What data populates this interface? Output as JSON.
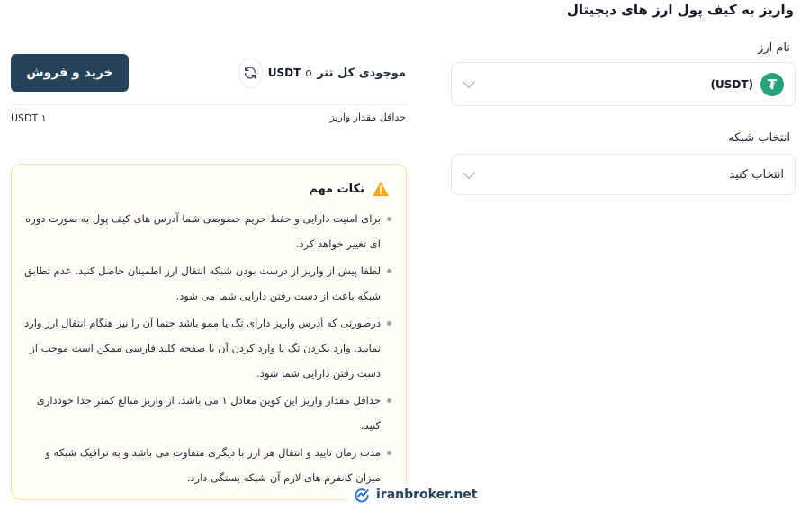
{
  "page": {
    "title": "واریز به کیف پول ارز های دیجیتال"
  },
  "currency": {
    "label": "نام ارز",
    "selected_code": "(USDT)",
    "icon": "tether-icon"
  },
  "network": {
    "label": "انتخاب شبکه",
    "placeholder": "انتخاب کنید"
  },
  "trade": {
    "button_label": "خرید و فروش"
  },
  "balance": {
    "label": "موجودی کل تتر",
    "value": "USDT"
  },
  "min_deposit": {
    "label": "حداقل مقدار واریز",
    "value": "USDT ۱"
  },
  "notes": {
    "title": "نکات مهم",
    "items": [
      "برای امنیت دارایی و حفظ حریم خصوصی شما آدرس های کیف پول به صورت دوره ای تغییر خواهد کرد.",
      "لطفا پیش از واریز از درست بودن شبکه انتقال ارز اطمینان حاصل کنید. عدم تطابق شبکه باعث از دست رفتن دارایی شما می شود.",
      "درصورتی که آدرس واریز دارای تگ یا ممو باشد حتما آن را نیز هنگام انتقال ارز وارد نمایید. وارد نکردن تگ یا وارد کردن آن با صفحه کلید فارسی ممکن است موجب از دست رفتن دارایی شما شود.",
      "حداقل مقدار واریز این کوین معادل ۱ می باشد. از واریز مبالغ کمتر جدا خودداری کنید.",
      "مدت زمان تایید و انتقال هر ارز با دیگری متفاوت می باشد و به ترافیک شبکه و میزان کانفرم های لازم آن شبکه بستگی دارد."
    ]
  },
  "watermark": {
    "text": "iranbroker.net"
  },
  "colors": {
    "primary": "#26425a",
    "tether": "#26a17b",
    "warning": "#f5a623"
  }
}
